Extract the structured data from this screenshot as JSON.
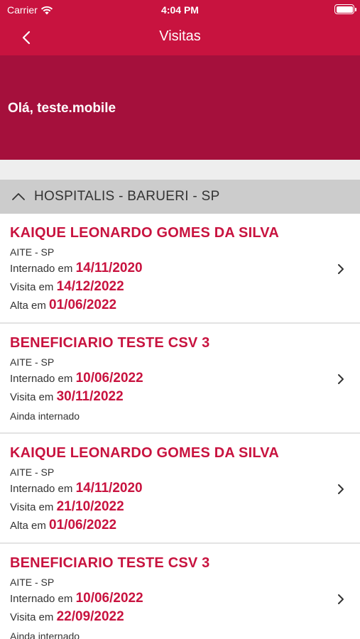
{
  "status_bar": {
    "carrier": "Carrier",
    "time": "4:04 PM"
  },
  "nav": {
    "title": "Visitas"
  },
  "banner": {
    "greeting": "Olá, teste.mobile"
  },
  "section": {
    "label": "HOSPITALIS - BARUERI - SP"
  },
  "visits": [
    {
      "name": "KAIQUE LEONARDO GOMES DA SILVA",
      "unit": "AITE - SP",
      "admitted_label": "Internado em",
      "admitted_date": "14/11/2020",
      "visit_label": "Visita em",
      "visit_date": "14/12/2022",
      "discharge_label": "Alta em",
      "discharge_date": "01/06/2022",
      "still_admitted_text": ""
    },
    {
      "name": "BENEFICIARIO TESTE CSV 3",
      "unit": "AITE - SP",
      "admitted_label": "Internado em",
      "admitted_date": "10/06/2022",
      "visit_label": "Visita em",
      "visit_date": "30/11/2022",
      "discharge_label": "",
      "discharge_date": "",
      "still_admitted_text": "Ainda internado"
    },
    {
      "name": "KAIQUE LEONARDO GOMES DA SILVA",
      "unit": "AITE - SP",
      "admitted_label": "Internado em",
      "admitted_date": "14/11/2020",
      "visit_label": "Visita em",
      "visit_date": "21/10/2022",
      "discharge_label": "Alta em",
      "discharge_date": "01/06/2022",
      "still_admitted_text": ""
    },
    {
      "name": "BENEFICIARIO TESTE CSV 3",
      "unit": "AITE - SP",
      "admitted_label": "Internado em",
      "admitted_date": "10/06/2022",
      "visit_label": "Visita em",
      "visit_date": "22/09/2022",
      "discharge_label": "",
      "discharge_date": "",
      "still_admitted_text": "Ainda internado"
    }
  ],
  "icons": {
    "back": "chevron-left-icon",
    "collapse": "chevron-up-icon",
    "row": "chevron-right-icon",
    "wifi": "wifi-icon",
    "battery": "battery-icon"
  },
  "colors": {
    "brand": "#c8133f",
    "banner": "#a5103c",
    "section_bg": "#cccccc"
  }
}
